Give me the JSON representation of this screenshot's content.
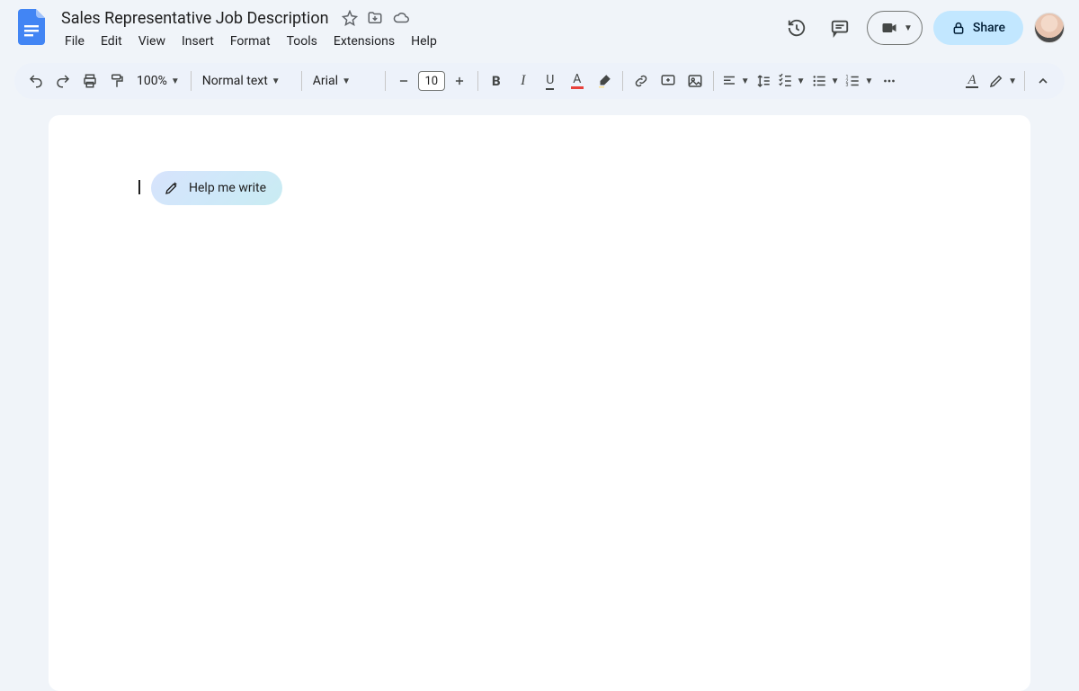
{
  "doc": {
    "title": "Sales Representative Job Description"
  },
  "menus": {
    "file": "File",
    "edit": "Edit",
    "view": "View",
    "insert": "Insert",
    "format": "Format",
    "tools": "Tools",
    "extensions": "Extensions",
    "help": "Help"
  },
  "header": {
    "share": "Share"
  },
  "toolbar": {
    "zoom": "100%",
    "style": "Normal text",
    "font": "Arial",
    "fontSize": "10"
  },
  "assist": {
    "helpWrite": "Help me write"
  }
}
